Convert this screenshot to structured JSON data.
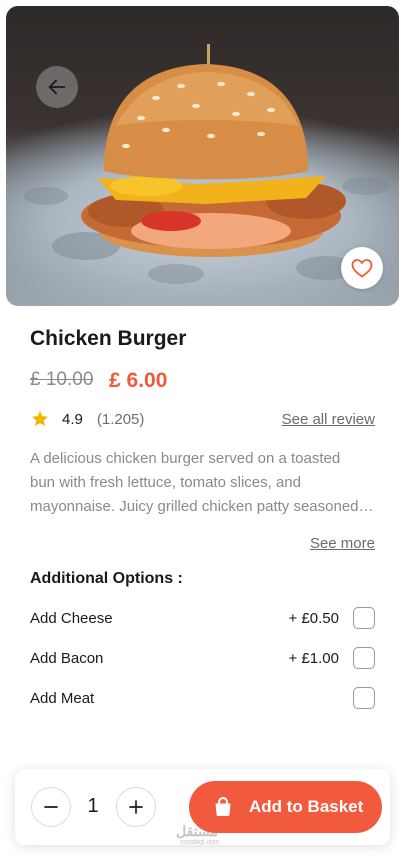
{
  "product": {
    "name": "Chicken Burger",
    "old_price": "£ 10.00",
    "price": "£ 6.00",
    "rating": "4.9",
    "review_count": "(1.205)",
    "see_all_label": "See all review",
    "description_lines": [
      "A delicious chicken burger served on a toasted",
      "bun with fresh lettuce, tomato slices, and",
      "mayonnaise. Juicy grilled chicken patty seasoned with"
    ],
    "see_more_label": "See more"
  },
  "options": {
    "title": "Additional Options :",
    "items": [
      {
        "name": "Add Cheese",
        "price": "+ £0.50"
      },
      {
        "name": "Add Bacon",
        "price": "+ £1.00"
      },
      {
        "name": "Add Meat",
        "price": ""
      }
    ]
  },
  "cart": {
    "quantity": "1",
    "add_label": "Add to Basket"
  },
  "watermark": {
    "logo": "مستقل",
    "site": "mostaql.com"
  },
  "colors": {
    "accent": "#f15a3c",
    "star": "#f5b400"
  },
  "icons": {
    "back": "arrow-left-icon",
    "favorite": "heart-icon",
    "star": "star-icon",
    "minus": "minus-icon",
    "plus": "plus-icon",
    "basket": "shopping-bag-icon"
  }
}
